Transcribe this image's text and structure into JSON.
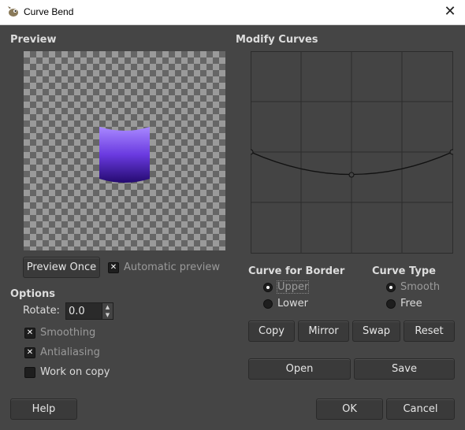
{
  "window": {
    "title": "Curve Bend",
    "close_glyph": "✕",
    "icon": "gimp-wilber-icon"
  },
  "preview": {
    "heading": "Preview",
    "preview_once_label": "Preview Once",
    "automatic_preview": {
      "label": "Automatic preview",
      "checked": true
    }
  },
  "options": {
    "heading": "Options",
    "rotate_label": "Rotate:",
    "rotate_value": "0.0",
    "smoothing": {
      "label": "Smoothing",
      "checked": true
    },
    "antialiasing": {
      "label": "Antialiasing",
      "checked": true
    },
    "work_on_copy": {
      "label": "Work on copy",
      "checked": false
    }
  },
  "curves": {
    "heading": "Modify Curves",
    "border_heading": "Curve for Border",
    "border_options": [
      {
        "label": "Upper",
        "selected": true
      },
      {
        "label": "Lower",
        "selected": false
      }
    ],
    "type_heading": "Curve Type",
    "type_options": [
      {
        "label": "Smooth",
        "selected": true
      },
      {
        "label": "Free",
        "selected": false
      }
    ],
    "buttons": {
      "copy": "Copy",
      "mirror": "Mirror",
      "swap": "Swap",
      "reset": "Reset",
      "open": "Open",
      "save": "Save"
    }
  },
  "footer": {
    "help": "Help",
    "ok": "OK",
    "cancel": "Cancel"
  },
  "colors": {
    "accent_purple": "#7b4ae8",
    "dark_purple": "#2a0e78",
    "dialog_bg": "#454545"
  }
}
